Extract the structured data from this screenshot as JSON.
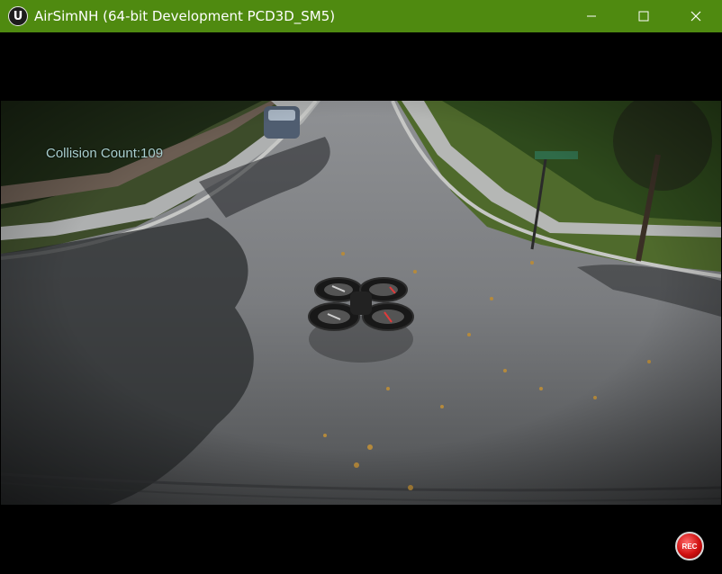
{
  "window": {
    "title": "AirSimNH (64-bit Development PCD3D_SM5)",
    "app_icon_glyph": "U",
    "titlebar_color": "#4f8a10",
    "controls": [
      "minimize-icon",
      "maximize-icon",
      "close-icon"
    ]
  },
  "hud": {
    "collision_count": "Collision Count:109"
  },
  "record_button": {
    "label": "REC",
    "icon": "record-icon",
    "color": "#d01010"
  }
}
